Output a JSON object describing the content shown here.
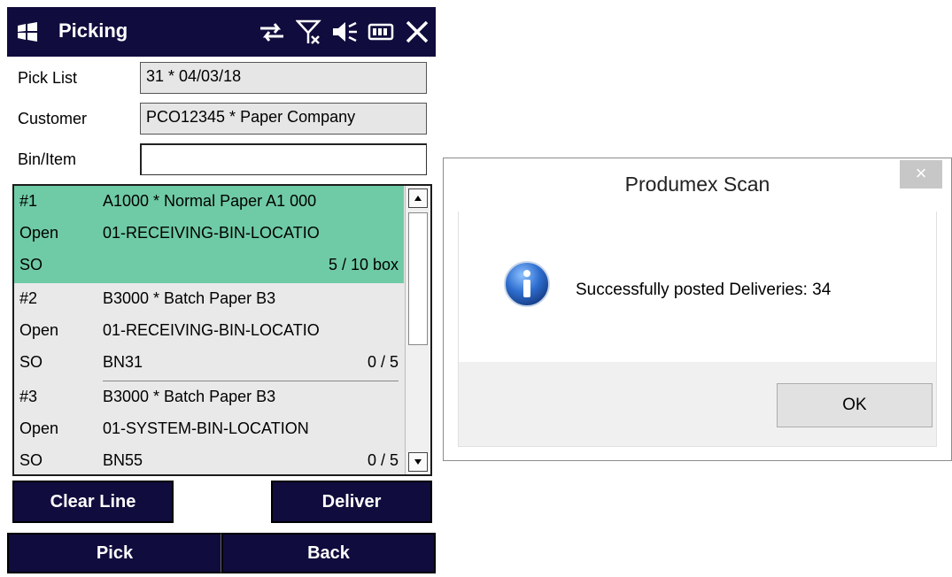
{
  "device": {
    "app_title": "Picking",
    "logo_icon": "windows-flag-icon",
    "status_icons": [
      "sync-arrows-icon",
      "no-signal-icon",
      "speaker-icon",
      "battery-icon",
      "close-icon"
    ],
    "fields": {
      "pick_list": {
        "label": "Pick List",
        "value": "31 * 04/03/18"
      },
      "customer": {
        "label": "Customer",
        "value": "PCO12345 * Paper Company"
      },
      "bin_item": {
        "label": "Bin/Item",
        "value": ""
      }
    },
    "items": [
      {
        "number": "#1",
        "item": "A1000 * Normal Paper A1 000",
        "status": "Open",
        "bin": "01-RECEIVING-BIN-LOCATIO",
        "type": "SO",
        "batch": "",
        "qty": "5 / 10 box",
        "selected": true
      },
      {
        "number": "#2",
        "item": "B3000 * Batch Paper B3",
        "status": "Open",
        "bin": "01-RECEIVING-BIN-LOCATIO",
        "type": "SO",
        "batch": "BN31",
        "qty": "0 / 5",
        "selected": false
      },
      {
        "number": "#3",
        "item": "B3000 * Batch Paper B3",
        "status": "Open",
        "bin": "01-SYSTEM-BIN-LOCATION",
        "type": "SO",
        "batch": "BN55",
        "qty": "0 / 5",
        "selected": false
      }
    ],
    "buttons": {
      "clear_line": "Clear Line",
      "deliver": "Deliver",
      "pick": "Pick",
      "back": "Back"
    },
    "colors": {
      "titlebar": "#100c3d",
      "selected_row": "#6fcba6"
    }
  },
  "dialog": {
    "title": "Produmex Scan",
    "close_glyph": "×",
    "icon": "info-icon",
    "message": "Successfully posted Deliveries: 34",
    "ok_label": "OK"
  }
}
